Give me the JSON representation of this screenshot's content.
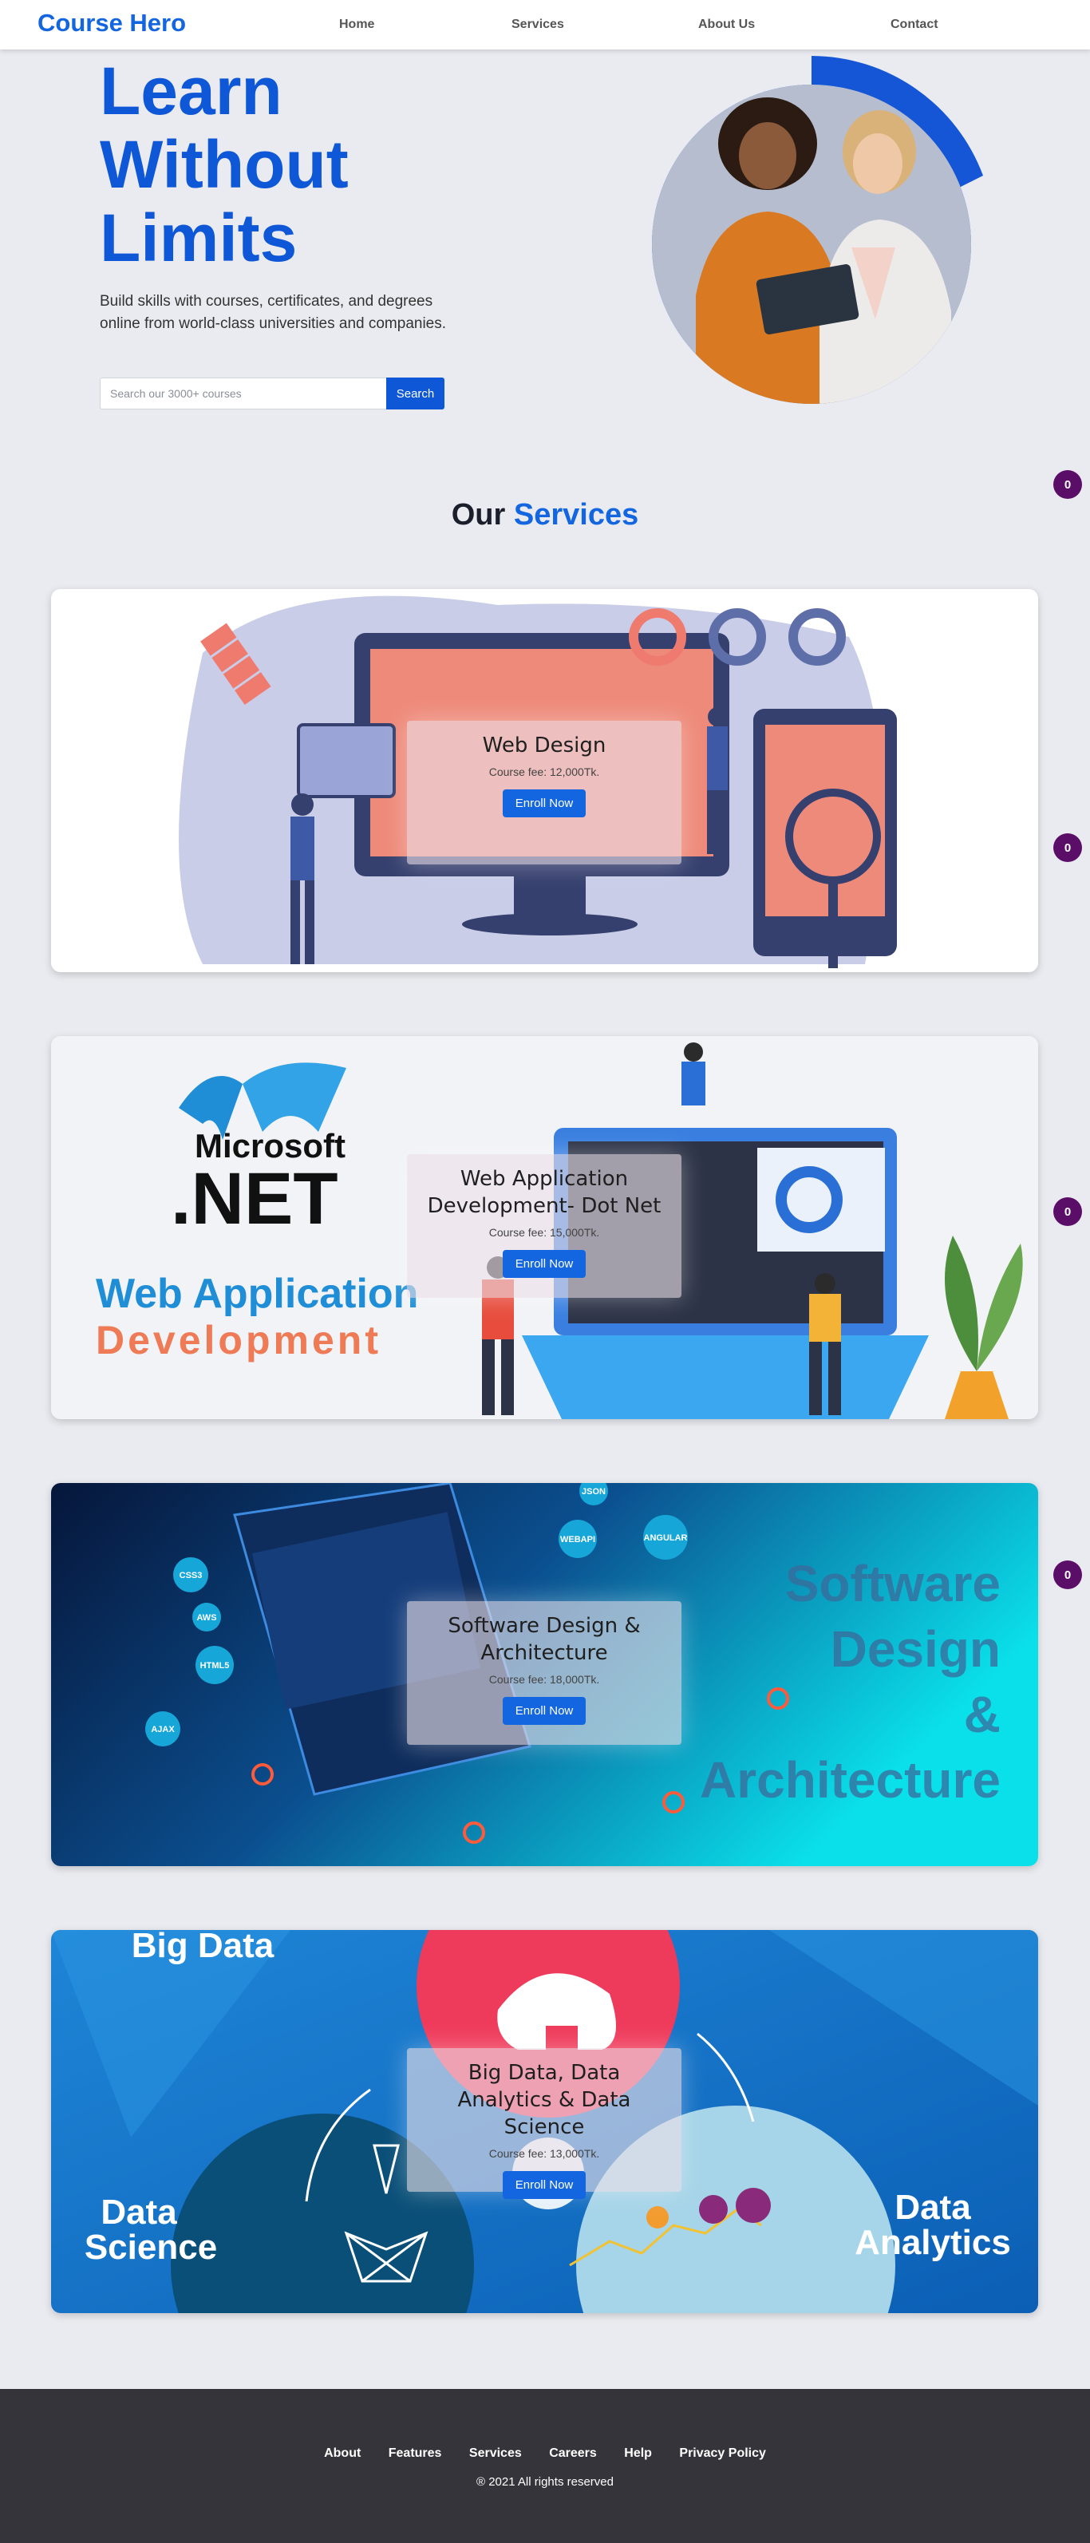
{
  "nav": {
    "brand": "Course Hero",
    "links": [
      "Home",
      "Services",
      "About Us",
      "Contact"
    ]
  },
  "hero": {
    "title_lines": [
      "Learn",
      "Without",
      "Limits"
    ],
    "subtitle": "Build skills with courses, certificates, and degrees online from world-class universities and companies.",
    "search_placeholder": "Search our 3000+ courses",
    "search_button": "Search"
  },
  "services": {
    "heading_plain": "Our",
    "heading_accent": "Services"
  },
  "badges": [
    "0",
    "0",
    "0",
    "0"
  ],
  "courses": [
    {
      "title": "Web Design",
      "fee": "Course fee: 12,000Tk.",
      "button": "Enroll Now"
    },
    {
      "title": "Web Application Development- Dot Net",
      "fee": "Course fee: 15,000Tk.",
      "button": "Enroll Now",
      "image_text": {
        "brand": "Microsoft",
        "net": ".NET",
        "line1": "Web Application",
        "line2": "Development"
      }
    },
    {
      "title": "Software Design & Architecture",
      "fee": "Course fee: 18,000Tk.",
      "button": "Enroll Now",
      "image_text": {
        "lines": [
          "Software",
          "Design",
          "&",
          "Architecture"
        ],
        "bubbles": [
          "CSS3",
          "AWS",
          "HTML5",
          "AJAX",
          "WEBAPI",
          "ANGULAR",
          "JSON"
        ]
      }
    },
    {
      "title": "Big Data, Data Analytics & Data Science",
      "fee": "Course fee: 13,000Tk.",
      "button": "Enroll Now",
      "image_text": {
        "big_data": "Big Data",
        "data_science": [
          "Data",
          "Science"
        ],
        "data_analytics": [
          "Data",
          "Analytics"
        ]
      }
    }
  ],
  "footer": {
    "links": [
      "About",
      "Features",
      "Services",
      "Careers",
      "Help",
      "Privacy Policy"
    ],
    "copyright": "® 2021 All rights reserved"
  },
  "colors": {
    "brand_blue": "#1466e0",
    "badge_purple": "#5a0e68",
    "footer_bg": "#34343a",
    "page_bg": "#e9ebf0"
  }
}
